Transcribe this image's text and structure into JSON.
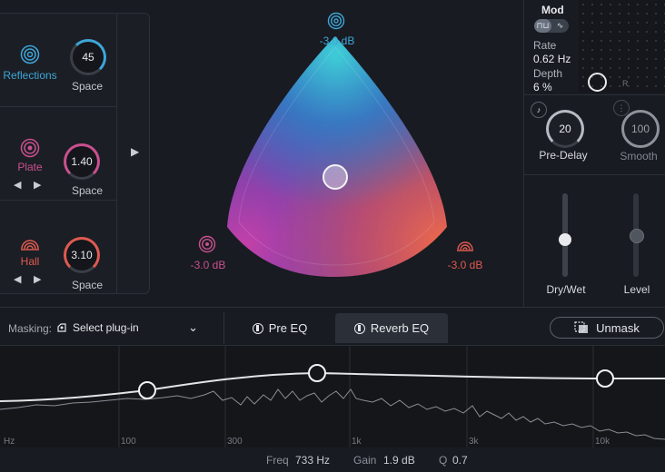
{
  "sources": [
    {
      "label": "Reflections",
      "value": "45",
      "sub": "Space",
      "color": "#3ea6d8"
    },
    {
      "label": "Plate",
      "value": "1.40",
      "sub": "Space",
      "color": "#c9508f"
    },
    {
      "label": "Hall",
      "value": "3.10",
      "sub": "Space",
      "color": "#e05a52"
    }
  ],
  "arrows": {
    "left": "◀",
    "right": "▶"
  },
  "expand": "▶",
  "blend": {
    "top": "-3.0 dB",
    "left": "-3.0 dB",
    "right": "-3.0 dB"
  },
  "mod": {
    "title": "Mod",
    "toggle": [
      "⊓⊔",
      "∿"
    ],
    "rate_label": "Rate",
    "rate_value": "0.62 Hz",
    "depth_label": "Depth",
    "depth_value": "6 %",
    "r_label": "R"
  },
  "predelay": {
    "value": "20",
    "label": "Pre-Delay",
    "note": "♪"
  },
  "smooth": {
    "value": "100",
    "label": "Smooth"
  },
  "dry_wet": {
    "label": "Dry/Wet",
    "level": 0.45
  },
  "level": {
    "label": "Level",
    "level": 0.5
  },
  "masking": {
    "label": "Masking:",
    "plugin": "Select plug-in",
    "chevron": "⌄"
  },
  "tabs": {
    "pre_eq": "Pre EQ",
    "reverb_eq": "Reverb EQ"
  },
  "unmask": "Unmask",
  "freq_labels": [
    "Hz",
    "100",
    "300",
    "1k",
    "3k",
    "10k"
  ],
  "status": {
    "freq_label": "Freq",
    "freq_value": "733 Hz",
    "gain_label": "Gain",
    "gain_value": "1.9 dB",
    "q_label": "Q",
    "q_value": "0.7"
  },
  "colors": {
    "accent_blue": "#3ea6d8",
    "accent_pink": "#c9508f",
    "accent_red": "#e05a52",
    "bg": "#181b21"
  }
}
